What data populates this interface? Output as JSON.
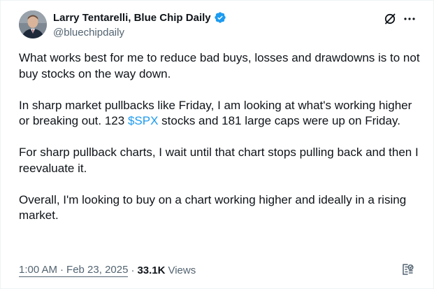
{
  "author": {
    "display_name": "Larry Tentarelli, Blue Chip Daily",
    "handle": "@bluechipdaily",
    "verified_color": "#1d9bf0"
  },
  "actions": {
    "grok_icon": "grok-icon",
    "more_icon": "more-icon"
  },
  "tweet": {
    "p1": "What works best for me to reduce bad buys, losses and drawdowns is to not buy stocks on the way down.",
    "p2_before": "In sharp market pullbacks like Friday, I am looking at what's working higher or breaking out. 123 ",
    "p2_cashtag": "$SPX",
    "p2_after": " stocks and 181 large caps were up on Friday.",
    "p3": "For sharp pullback charts, I wait until that chart stops pulling back and then I reevaluate it.",
    "p4": "Overall, I'm looking to buy on a chart working higher and ideally in a rising market."
  },
  "meta": {
    "time": "1:00 AM",
    "separator": "·",
    "date": "Feb 23, 2025",
    "views_count": "33.1K",
    "views_label": "Views"
  },
  "colors": {
    "link": "#1d9bf0",
    "secondary_text": "#536471",
    "primary_text": "#0f1419"
  }
}
